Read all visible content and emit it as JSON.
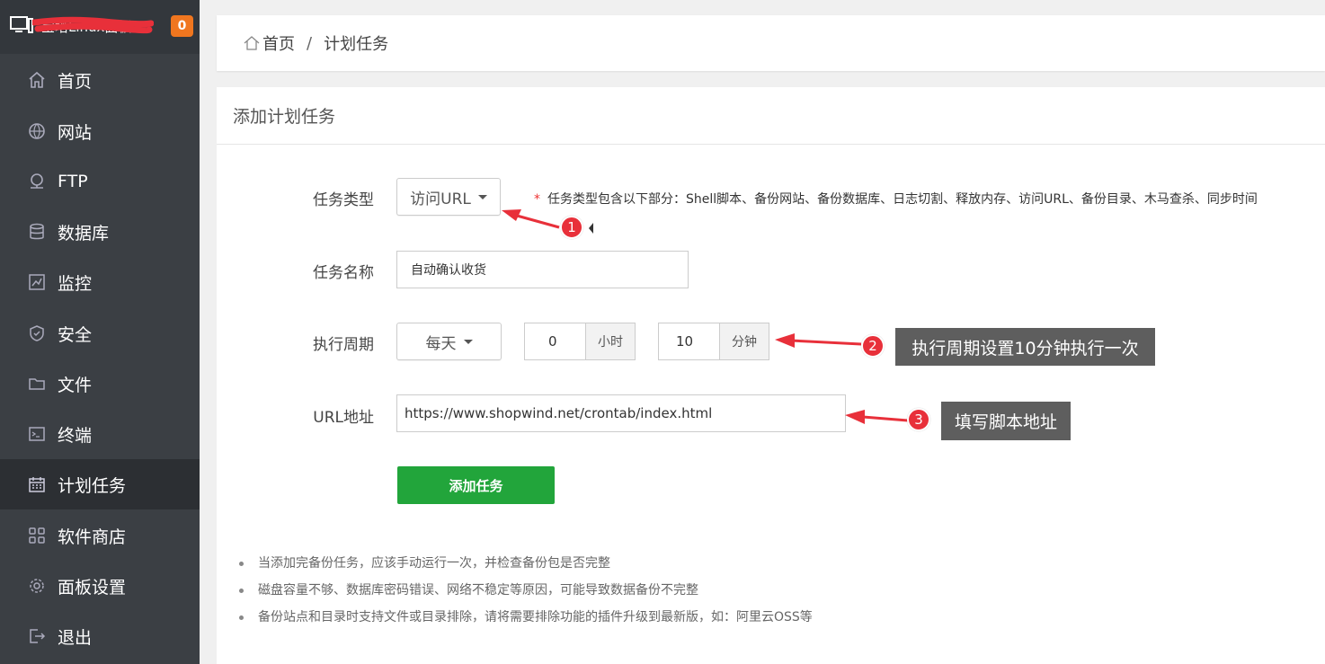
{
  "sidebar": {
    "brand_name": "宝塔Linux面板",
    "badge": "0",
    "items": [
      {
        "label": "首页",
        "icon": "home-icon"
      },
      {
        "label": "网站",
        "icon": "globe-icon"
      },
      {
        "label": "FTP",
        "icon": "ftp-icon"
      },
      {
        "label": "数据库",
        "icon": "database-icon"
      },
      {
        "label": "监控",
        "icon": "monitor-chart-icon"
      },
      {
        "label": "安全",
        "icon": "shield-icon"
      },
      {
        "label": "文件",
        "icon": "folder-icon"
      },
      {
        "label": "终端",
        "icon": "terminal-icon"
      },
      {
        "label": "计划任务",
        "icon": "calendar-icon",
        "active": true
      },
      {
        "label": "软件商店",
        "icon": "grid-icon"
      },
      {
        "label": "面板设置",
        "icon": "gear-icon"
      },
      {
        "label": "退出",
        "icon": "logout-icon"
      }
    ]
  },
  "breadcrumb": {
    "home": "首页",
    "sep": "/",
    "current": "计划任务"
  },
  "panel": {
    "title": "添加计划任务",
    "form": {
      "task_type_label": "任务类型",
      "task_type_value": "访问URL",
      "task_type_hint_star": "*",
      "task_type_hint": "任务类型包含以下部分：Shell脚本、备份网站、备份数据库、日志切割、释放内存、访问URL、备份目录、木马查杀、同步时间",
      "task_name_label": "任务名称",
      "task_name_value": "自动确认收货",
      "cycle_label": "执行周期",
      "cycle_value": "每天",
      "hour_value": "0",
      "hour_unit": "小时",
      "minute_value": "10",
      "minute_unit": "分钟",
      "url_label": "URL地址",
      "url_value": "https://www.shopwind.net/crontab/index.html",
      "submit_label": "添加任务"
    },
    "tips": [
      "当添加完备份任务，应该手动运行一次，并检查备份包是否完整",
      "磁盘容量不够、数据库密码错误、网络不稳定等原因，可能导致数据备份不完整",
      "备份站点和目录时支持文件或目录排除，请将需要排除功能的插件升级到最新版，如：阿里云OSS等"
    ]
  },
  "annotations": {
    "marker1": "1",
    "marker2": "2",
    "marker3": "3",
    "callout2": "执行周期设置10分钟执行一次",
    "callout3": "填写脚本地址"
  },
  "colors": {
    "sidebar_bg": "#3b3f44",
    "sidebar_active": "#2c2f33",
    "badge": "#f0761f",
    "submit_green": "#22a53b",
    "annotation_red": "#e8303a",
    "callout_gray": "#5e5e5e"
  }
}
